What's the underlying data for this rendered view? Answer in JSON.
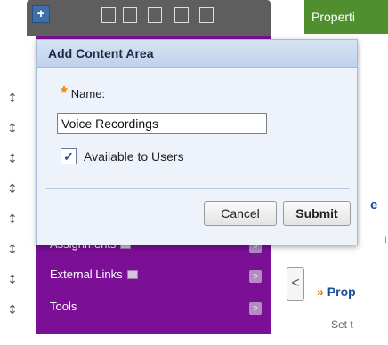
{
  "dialog": {
    "title": "Add Content Area",
    "name_label": "Name:",
    "name_value": "Voice Recordings",
    "available_label": "Available to Users",
    "available_checked": true,
    "cancel_label": "Cancel",
    "submit_label": "Submit"
  },
  "menu": {
    "items": [
      {
        "label": "Assignments"
      },
      {
        "label": "External Links"
      },
      {
        "label": "Tools"
      }
    ]
  },
  "content": {
    "tab_label": "Properti",
    "link_label": "Prop",
    "link_chevron": "»",
    "description_fragment": "Set t",
    "fragment_e": "e",
    "fragment_small": "I"
  },
  "icons": {
    "plus": "+",
    "checkmark": "✓",
    "collapse": "<",
    "drag_handle": "↕",
    "menu_expand": "»"
  },
  "colors": {
    "menu_purple": "#7b0f96",
    "action_green": "#4f8f2f",
    "required_orange": "#f08a00",
    "link_blue": "#1a4c9a"
  }
}
